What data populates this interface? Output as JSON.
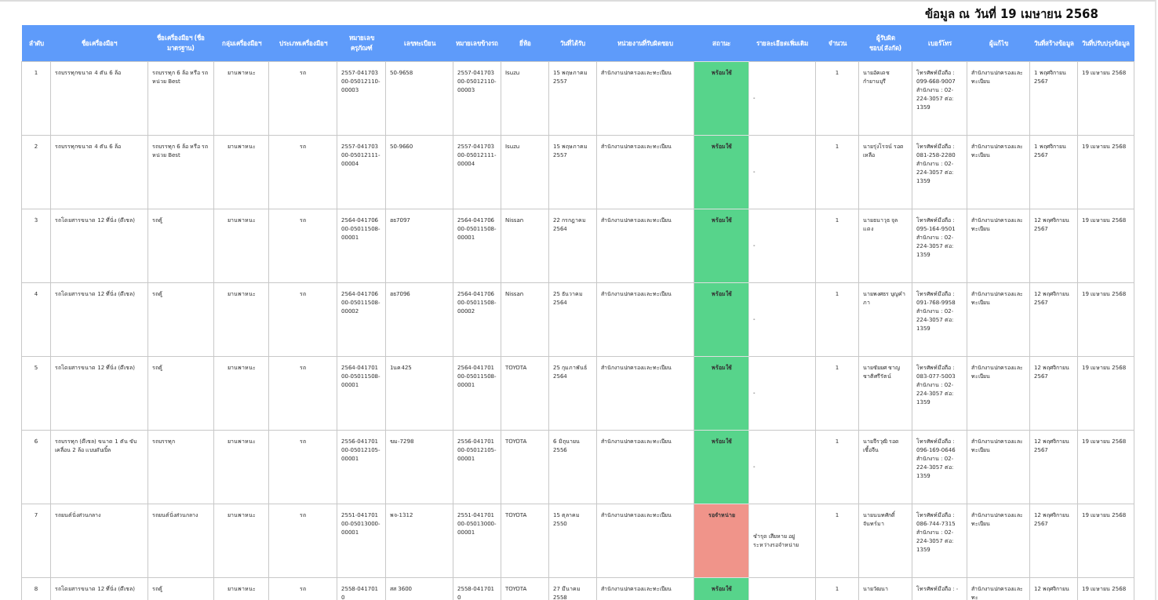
{
  "title": "ข้อมูล ณ วันที่ 19 เมษายน 2568",
  "table": {
    "columns": [
      "ลำดับ",
      "ชื่อเครื่องมือฯ",
      "ชื่อเครื่องมือฯ (ชื่อมาตรฐาน)",
      "กลุ่มเครื่องมือฯ",
      "ประเภทเครื่องมือฯ",
      "หมายเลขครุภัณฑ์",
      "เลขทะเบียน",
      "หมายเลขข้างรถ",
      "ยี่ห้อ",
      "วันที่ได้รับ",
      "หน่วยงานที่รับผิดชอบ",
      "สถานะ",
      "รายละเอียดเพิ่มเติม",
      "จำนวน",
      "ผู้รับผิดชอบ(สังกัด)",
      "เบอร์โทร",
      "ผู้แก้ไข",
      "วันที่สร้างข้อมูล",
      "วันที่ปรับปรุงข้อมูล"
    ],
    "rows": [
      {
        "no": "1",
        "name": "รถบรรทุกขนาด 4 ตัน 6 ล้อ",
        "standard_name": "รถบรรทุก 6 ล้อ หรือ รถหน่วย Best",
        "group": "ยานพาหนะ",
        "type": "รถ",
        "asset_no": "2557-04170300-05012110-00003",
        "plate": "50-9658",
        "body_no": " 2557-04170300-05012110-00003",
        "brand": "Isuzu",
        "received": "15 พฤษภาคม 2557",
        "unit": "สำนักงานปกครองและทะเบียน",
        "status": {
          "text": "พร้อมใช้",
          "color": "#57d48b"
        },
        "details": "-",
        "qty": "1",
        "responsible": "นายอัคเดช กำยานบุรี",
        "phone": "โทรศัพท์มือถือ : 099-668-9007 สำนักงาน : 02-224-3057  ต่อ: 1359",
        "editor": "สำนักงานปกครองและทะเบียน",
        "created": "1 พฤศจิกายน 2567",
        "updated": "19 เมษายน 2568"
      },
      {
        "no": "2",
        "name": "รถบรรทุกขนาด 4 ตัน 6 ล้อ",
        "standard_name": "รถบรรทุก 6 ล้อ หรือ รถหน่วย Best",
        "group": "ยานพาหนะ",
        "type": "รถ",
        "asset_no": "2557-04170300-05012111-00004",
        "plate": "50-9660",
        "body_no": " 2557-04170300-05012111-00004",
        "brand": "Isuzu",
        "received": "15 พฤษภาคม 2557",
        "unit": "สำนักงานปกครองและทะเบียน",
        "status": {
          "text": "พร้อมใช้",
          "color": "#57d48b"
        },
        "details": "-",
        "qty": "1",
        "responsible": "นายรุ่งโรจน์ รอดเหลือ",
        "phone": "โทรศัพท์มือถือ : 081-258-2280 สำนักงาน : 02-224-3057  ต่อ: 1359",
        "editor": "สำนักงานปกครองและทะเบียน",
        "created": "1 พฤศจิกายน 2567",
        "updated": "19 เมษายน 2568"
      },
      {
        "no": "3",
        "name": "รถโดยสารขนาด 12 ที่นั่ง (ดีเซล)",
        "standard_name": "รถตู้",
        "group": "ยานพาหนะ",
        "type": "รถ",
        "asset_no": "2564-04170600-05011508-00001",
        "plate": "ฮธ7097",
        "body_no": " 2564-04170600-05011508-00001",
        "brand": "Nissan",
        "received": "22 กรกฎาคม 2564",
        "unit": "สำนักงานปกครองและทะเบียน",
        "status": {
          "text": "พร้อมใช้",
          "color": "#57d48b"
        },
        "details": "-",
        "qty": "1",
        "responsible": "นายธนาวุธ จุลแดง",
        "phone": "โทรศัพท์มือถือ : 095-164-9501 สำนักงาน : 02-224-3057  ต่อ: 1359",
        "editor": "สำนักงานปกครองและทะเบียน",
        "created": "12 พฤศจิกายน 2567",
        "updated": "19 เมษายน 2568"
      },
      {
        "no": "4",
        "name": "รถโดยสารขนาด 12 ที่นั่ง (ดีเซล)",
        "standard_name": "รถตู้",
        "group": "ยานพาหนะ",
        "type": "รถ",
        "asset_no": "2564-04170600-05011508-00002",
        "plate": "ฮธ7096",
        "body_no": " 2564-04170600-05011508-00002",
        "brand": "Nissan",
        "received": "25 ธันวาคม 2564",
        "unit": "สำนักงานปกครองและทะเบียน",
        "status": {
          "text": "พร้อมใช้",
          "color": "#57d48b"
        },
        "details": "-",
        "qty": "1",
        "responsible": "นายพงศธร บุญคำภา",
        "phone": "โทรศัพท์มือถือ : 091-768-9958 สำนักงาน : 02-224-3057  ต่อ: 1359",
        "editor": "สำนักงานปกครองและทะเบียน",
        "created": "12 พฤศจิกายน 2567",
        "updated": "19 เมษายน 2568"
      },
      {
        "no": "5",
        "name": "รถโดยสารขนาด 12 ที่นั่ง (ดีเซล)",
        "standard_name": "รถตู้",
        "group": "ยานพาหนะ",
        "type": "รถ",
        "asset_no": "2564-04170100-05011508-00001",
        "plate": "1นค425",
        "body_no": " 2564-04170100-05011508-00001",
        "brand": "TOYOTA",
        "received": "25 กุมภาพันธ์ 2564",
        "unit": "สำนักงานปกครองและทะเบียน",
        "status": {
          "text": "พร้อมใช้",
          "color": "#57d48b"
        },
        "details": "-",
        "qty": "1",
        "responsible": "นายชัยยศ ชาญชาติศรีรัตน์",
        "phone": "โทรศัพท์มือถือ : 083-077-5003 สำนักงาน : 02-224-3057  ต่อ: 1359",
        "editor": "สำนักงานปกครองและทะเบียน",
        "created": "12 พฤศจิกายน 2567",
        "updated": "19 เมษายน 2568"
      },
      {
        "no": "6",
        "name": "รถบรรทุก (ดีเซล) ขนาด 1 ตัน ขับเคลื่อน 2 ล้อ แบบดับเบิ้ล",
        "standard_name": "รถบรรทุก",
        "group": "ยานพาหนะ",
        "type": "รถ",
        "asset_no": "2556-04170100-05012105-00001",
        "plate": "ฆม-7298",
        "body_no": " 2556-04170100-05012105-00001",
        "brand": "TOYOTA",
        "received": "6 มิถุนายน 2556",
        "unit": "สำนักงานปกครองและทะเบียน",
        "status": {
          "text": "พร้อมใช้",
          "color": "#57d48b"
        },
        "details": "-",
        "qty": "1",
        "responsible": "นายจีรวุฒิ รอดเชื้อจีน",
        "phone": "โทรศัพท์มือถือ : 096-169-0646 สำนักงาน : 02-224-3057  ต่อ: 1359",
        "editor": "สำนักงานปกครองและทะเบียน",
        "created": "12 พฤศจิกายน 2567",
        "updated": "19 เมษายน 2568"
      },
      {
        "no": "7",
        "name": "รถยนต์นั่งส่วนกลาง",
        "standard_name": "รถยนต์นั่งส่วนกลาง",
        "group": "ยานพาหนะ",
        "type": "รถ",
        "asset_no": "2551-04170100-05013000-00001",
        "plate": "พจ-1312",
        "body_no": " 2551-04170100-05013000-00001",
        "brand": "TOYOTA",
        "received": "15 ตุลาคม 2550",
        "unit": "สำนักงานปกครองและทะเบียน",
        "status": {
          "text": "รอจำหน่าย",
          "color": "#f0948a"
        },
        "details": "ชำรุด เสียหาย อยู่ระหว่างรอจำหน่าย",
        "qty": "1",
        "responsible": "นายนนทศักดิ์ จันทร์มา",
        "phone": "โทรศัพท์มือถือ : 086-744-7315 สำนักงาน : 02-224-3057  ต่อ: 1359",
        "editor": "สำนักงานปกครองและทะเบียน",
        "created": "12 พฤศจิกายน 2567",
        "updated": "19 เมษายน 2568"
      },
      {
        "no": "8",
        "name": "รถโดยสารขนาด 12 ที่นั่ง (ดีเซล)",
        "standard_name": "รถตู้",
        "group": "ยานพาหนะ",
        "type": "รถ",
        "asset_no": "2558-0417010",
        "plate": "สส 3600",
        "body_no": " 2558-0417010",
        "brand": "TOYOTA",
        "received": "27 มีนาคม 2558",
        "unit": "สำนักงานปกครองและทะเบียน",
        "status": {
          "text": "พร้อมใช้",
          "color": "#57d48b"
        },
        "qty": "1",
        "responsible": "นายวัฒนา",
        "phone": "โทรศัพท์มือถือ : -",
        "editor": "สำนักงานปกครองและทะ",
        "created": "12 พฤศจิกายน",
        "updated": "19 เมษายน 2568"
      }
    ]
  }
}
